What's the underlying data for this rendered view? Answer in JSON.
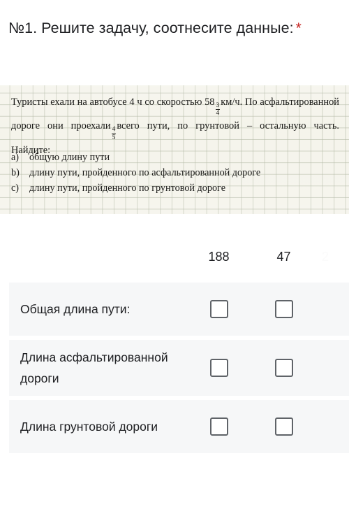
{
  "question": {
    "title": "№1. Решите задачу, соотнесите данные:",
    "required_marker": "*"
  },
  "problem_image": {
    "line1_before": "Туристы ехали на автобусе 4 ч со скоростью 58",
    "line1_frac_num": "3",
    "line1_frac_den": "4",
    "line1_after": "км/ч. По асфальтированной дороге они проехали",
    "line2_frac_num": "4",
    "line2_frac_den": "5",
    "line2_after": "всего пути, по грунтовой – остальную часть. Найдите:",
    "items": [
      {
        "marker": "a)",
        "text": "общую длину пути"
      },
      {
        "marker": "b)",
        "text": "длину пути, пройденного по асфальтированной дороге"
      },
      {
        "marker": "c)",
        "text": "длину пути, пройденного по грунтовой дороге"
      }
    ]
  },
  "grid": {
    "columns": [
      {
        "label": "188",
        "cut_off": false
      },
      {
        "label": "47",
        "cut_off": false
      },
      {
        "label": "2",
        "cut_off": true
      }
    ],
    "rows": [
      {
        "label": "Общая длина пути:"
      },
      {
        "label": "Длина асфальтированной дороги"
      },
      {
        "label": "Длина грунтовой дороги"
      }
    ]
  },
  "colors": {
    "text": "#202124",
    "required": "#c5221f",
    "row_background": "#f6f7f8",
    "checkbox_border": "#5f6368",
    "paper": "#f4f3ea"
  }
}
